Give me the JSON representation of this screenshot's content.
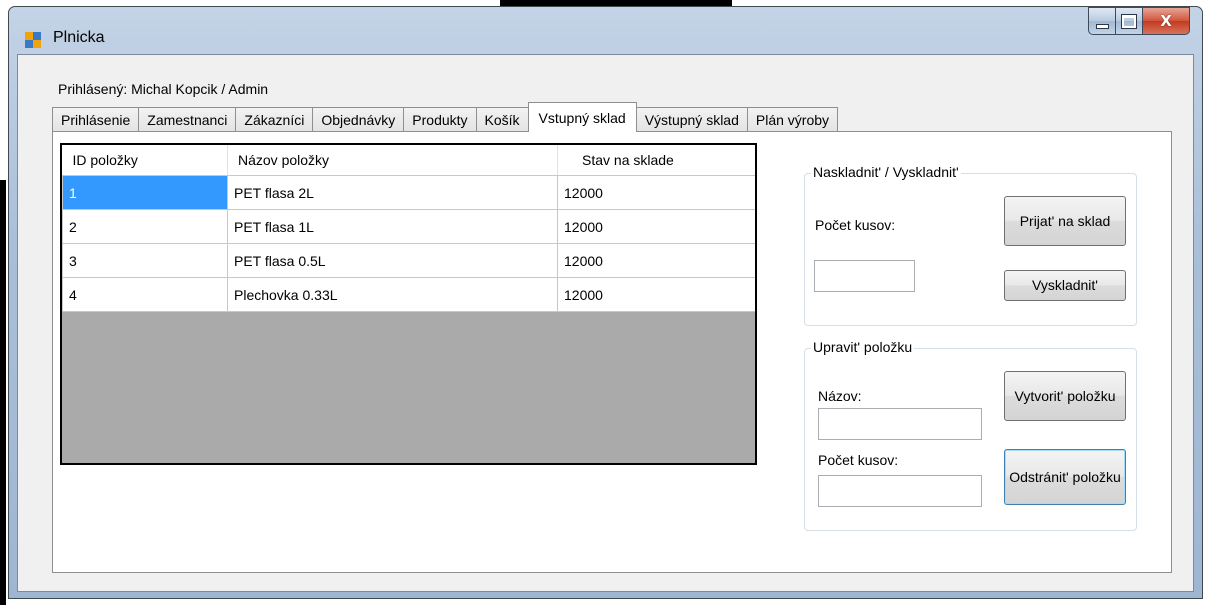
{
  "window": {
    "title": "Plnicka",
    "icon": "app-window-icon",
    "controls": [
      "minimize-icon",
      "maximize-icon",
      "close-icon"
    ],
    "close_glyph": "X"
  },
  "status": {
    "logged_in": "Prihlásený: Michal Kopcik / Admin"
  },
  "tabs": [
    {
      "label": "Prihlásenie"
    },
    {
      "label": "Zamestnanci"
    },
    {
      "label": "Zákazníci"
    },
    {
      "label": "Objednávky"
    },
    {
      "label": "Produkty"
    },
    {
      "label": "Košík"
    },
    {
      "label": "Vstupný sklad",
      "active": true
    },
    {
      "label": "Výstupný sklad"
    },
    {
      "label": "Plán výroby"
    }
  ],
  "grid": {
    "columns": [
      "ID položky",
      "Názov položky",
      "Stav na sklade"
    ],
    "rows": [
      [
        "1",
        "PET flasa 2L",
        "12000"
      ],
      [
        "2",
        "PET flasa 1L",
        "12000"
      ],
      [
        "3",
        "PET flasa 0.5L",
        "12000"
      ],
      [
        "4",
        "Plechovka 0.33L",
        "12000"
      ]
    ],
    "selected_row": 0
  },
  "stock_group": {
    "title": "Naskladnit' / Vyskladnit'",
    "count_label": "Počet kusov:",
    "count_value": "",
    "receive_button": "Prijat' na sklad",
    "issue_button": "Vyskladnit'"
  },
  "edit_group": {
    "title": "Upravit' položku",
    "name_label": "Názov:",
    "name_value": "",
    "count_label": "Počet kusov:",
    "count_value": "",
    "create_button": "Vytvorit' položku",
    "delete_button": "Odstránit' položku"
  }
}
